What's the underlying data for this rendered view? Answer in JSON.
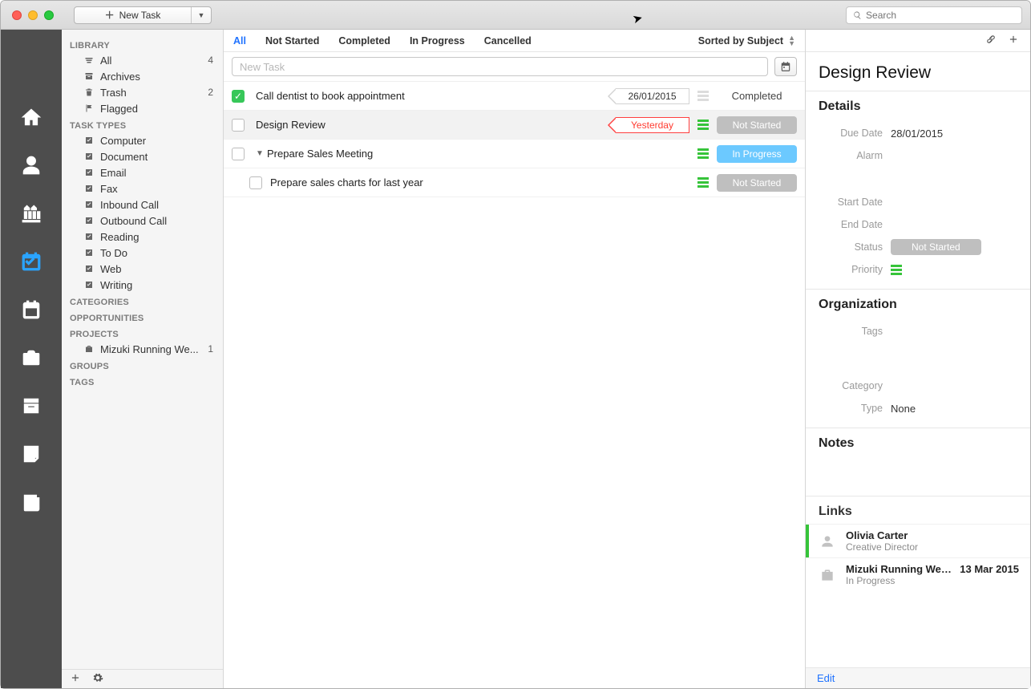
{
  "toolbar": {
    "new_task_label": "New Task",
    "search_placeholder": "Search"
  },
  "rail": {
    "items": [
      {
        "name": "home"
      },
      {
        "name": "contacts"
      },
      {
        "name": "organizations"
      },
      {
        "name": "tasks",
        "active": true
      },
      {
        "name": "calendar"
      },
      {
        "name": "briefcase"
      },
      {
        "name": "badge"
      },
      {
        "name": "note"
      },
      {
        "name": "news"
      }
    ]
  },
  "sidebar": {
    "sections": {
      "library": {
        "title": "LIBRARY",
        "items": [
          {
            "label": "All",
            "count": "4",
            "icon": "stack"
          },
          {
            "label": "Archives",
            "icon": "box"
          },
          {
            "label": "Trash",
            "count": "2",
            "icon": "trash"
          },
          {
            "label": "Flagged",
            "icon": "flag"
          }
        ]
      },
      "task_types": {
        "title": "TASK TYPES",
        "items": [
          {
            "label": "Computer"
          },
          {
            "label": "Document"
          },
          {
            "label": "Email"
          },
          {
            "label": "Fax"
          },
          {
            "label": "Inbound Call"
          },
          {
            "label": "Outbound Call"
          },
          {
            "label": "Reading"
          },
          {
            "label": "To Do"
          },
          {
            "label": "Web"
          },
          {
            "label": "Writing"
          }
        ]
      },
      "categories": {
        "title": "CATEGORIES"
      },
      "opportunities": {
        "title": "OPPORTUNITIES"
      },
      "projects": {
        "title": "PROJECTS",
        "items": [
          {
            "label": "Mizuki Running We...",
            "count": "1",
            "icon": "briefcase"
          }
        ]
      },
      "groups": {
        "title": "GROUPS"
      },
      "tags": {
        "title": "TAGS"
      }
    }
  },
  "filters": {
    "tabs": [
      "All",
      "Not Started",
      "Completed",
      "In Progress",
      "Cancelled"
    ],
    "active": "All",
    "sort_label": "Sorted by Subject"
  },
  "new_task_placeholder": "New Task",
  "tasks": [
    {
      "title": "Call dentist to book appointment",
      "done": true,
      "date": "26/01/2015",
      "date_style": "plain",
      "status": "Completed",
      "status_style": "completed",
      "priority_muted": true
    },
    {
      "title": "Design Review",
      "done": false,
      "date": "Yesterday",
      "date_style": "red",
      "status": "Not Started",
      "status_style": "not-started",
      "selected": true
    },
    {
      "title": "Prepare Sales Meeting",
      "done": false,
      "disclosure": true,
      "status": "In Progress",
      "status_style": "in-progress"
    },
    {
      "title": "Prepare sales charts for last year",
      "done": false,
      "child": true,
      "status": "Not Started",
      "status_style": "not-started"
    }
  ],
  "detail": {
    "title": "Design Review",
    "sections": {
      "details": {
        "title": "Details",
        "due_date_label": "Due Date",
        "due_date": "28/01/2015",
        "alarm_label": "Alarm",
        "start_date_label": "Start Date",
        "end_date_label": "End Date",
        "status_label": "Status",
        "status_value": "Not Started",
        "priority_label": "Priority"
      },
      "organization": {
        "title": "Organization",
        "tags_label": "Tags",
        "category_label": "Category",
        "type_label": "Type",
        "type_value": "None"
      },
      "notes": {
        "title": "Notes"
      },
      "links": {
        "title": "Links",
        "items": [
          {
            "name": "Olivia Carter",
            "subtitle": "Creative Director",
            "kind": "person",
            "stripe": "green"
          },
          {
            "name": "Mizuki Running Webs...",
            "subtitle": "In Progress",
            "kind": "project",
            "date": "13 Mar 2015"
          }
        ]
      }
    },
    "footer_edit": "Edit"
  }
}
